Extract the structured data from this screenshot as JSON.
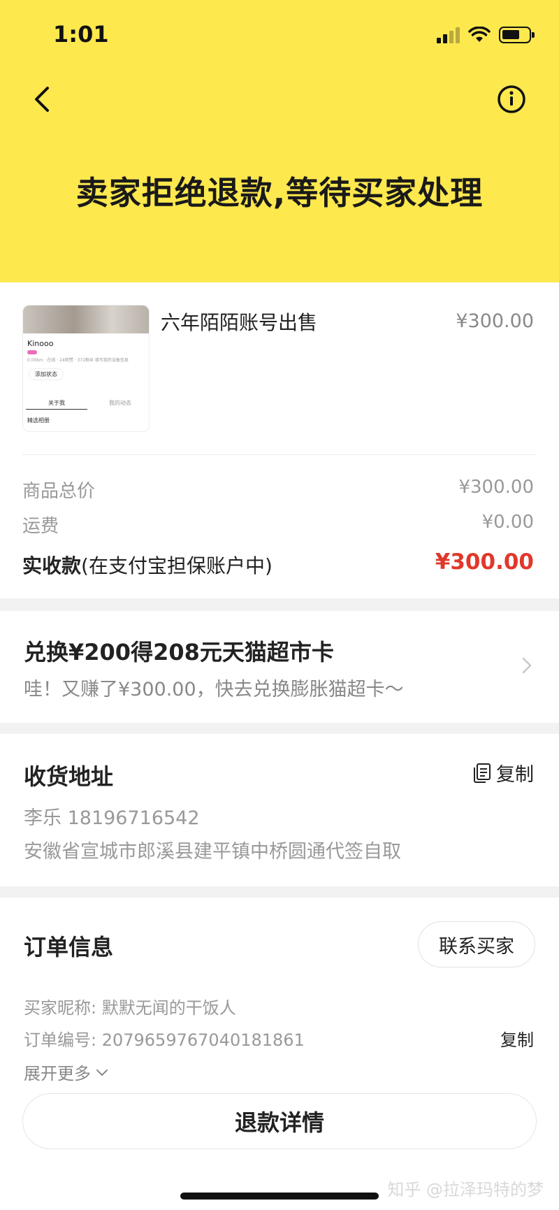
{
  "status_bar": {
    "time": "1:01"
  },
  "header": {
    "title": "卖家拒绝退款,等待买家处理",
    "bg_color": "#fde84e"
  },
  "product": {
    "title": "六年陌陌账号出售",
    "price": "¥300.00",
    "thumbnail": {
      "name": "Kinooo",
      "meta": "0.00km · 在线 · 24获赞 · 372粉丝  填写我的设备信息",
      "status_btn": "添加状态",
      "tab_about": "关于我",
      "tab_feed": "我的动态",
      "album": "精选相册"
    }
  },
  "price_summary": {
    "subtotal_label": "商品总价",
    "subtotal_value": "¥300.00",
    "shipping_label": "运费",
    "shipping_value": "¥0.00",
    "total_label_bold": "实收款",
    "total_label_note": "(在支付宝担保账户中)",
    "total_value": "¥300.00",
    "total_color": "#e0382b"
  },
  "promo": {
    "title": "兑换¥200得208元天猫超市卡",
    "subtitle": "哇！又赚了¥300.00，快去兑换膨胀猫超卡～"
  },
  "address": {
    "title": "收货地址",
    "copy_label": "复制",
    "name_phone": "李乐 18196716542",
    "detail": "安徽省宣城市郎溪县建平镇中桥圆通代签自取"
  },
  "order": {
    "title": "订单信息",
    "contact_label": "联系买家",
    "buyer_nick": "买家昵称: 默默无闻的干饭人",
    "order_no": "订单编号: 2079659767040181861",
    "copy_label": "复制",
    "expand_label": "展开更多",
    "refund_detail_label": "退款详情"
  },
  "watermark": "知乎 @拉泽玛特的梦"
}
